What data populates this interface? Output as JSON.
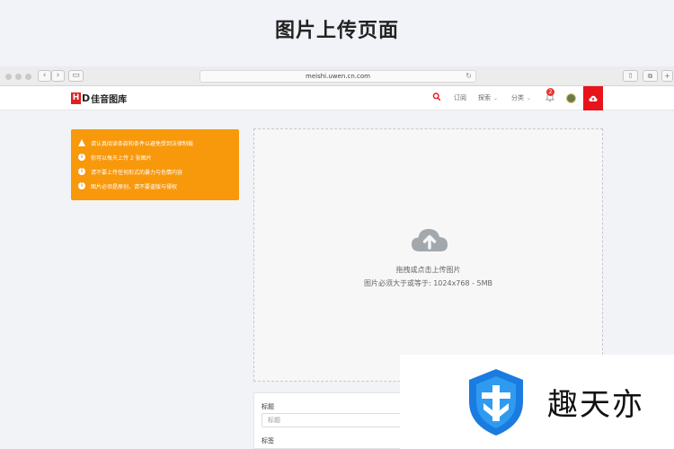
{
  "banner": {
    "title": "图片上传页面"
  },
  "browser": {
    "url": "meishi.uwen.cn.com"
  },
  "header": {
    "logo_mark": "H",
    "logo_d": "D",
    "logo_name": "佳音图库",
    "nav": [
      {
        "label": "订阅"
      },
      {
        "label": "探索",
        "dropdown": true
      },
      {
        "label": "分类",
        "dropdown": true
      }
    ],
    "notification_count": "2"
  },
  "notice": {
    "items": [
      {
        "icon": "warning-icon",
        "text": "请认真阅读条款和条件以避免受到法律制裁"
      },
      {
        "icon": "info-icon",
        "text": "你可以每天上传 2 张图片"
      },
      {
        "icon": "info-icon",
        "text": "请不要上传任何形式的暴力与色情内容"
      },
      {
        "icon": "info-icon",
        "text": "图片必须是原创，请不要盗版与侵权"
      }
    ]
  },
  "dropzone": {
    "line1": "拖拽或点击上传图片",
    "line2": "图片必须大于或等于: 1024x768 - 5MB"
  },
  "form": {
    "title_label": "标题",
    "title_placeholder": "标题",
    "tags_label": "标签"
  },
  "watermark": {
    "text": "趣天亦"
  },
  "colors": {
    "accent": "#e8141b",
    "notice_bg": "#f8980b",
    "brand_blue": "#1a7be0"
  }
}
